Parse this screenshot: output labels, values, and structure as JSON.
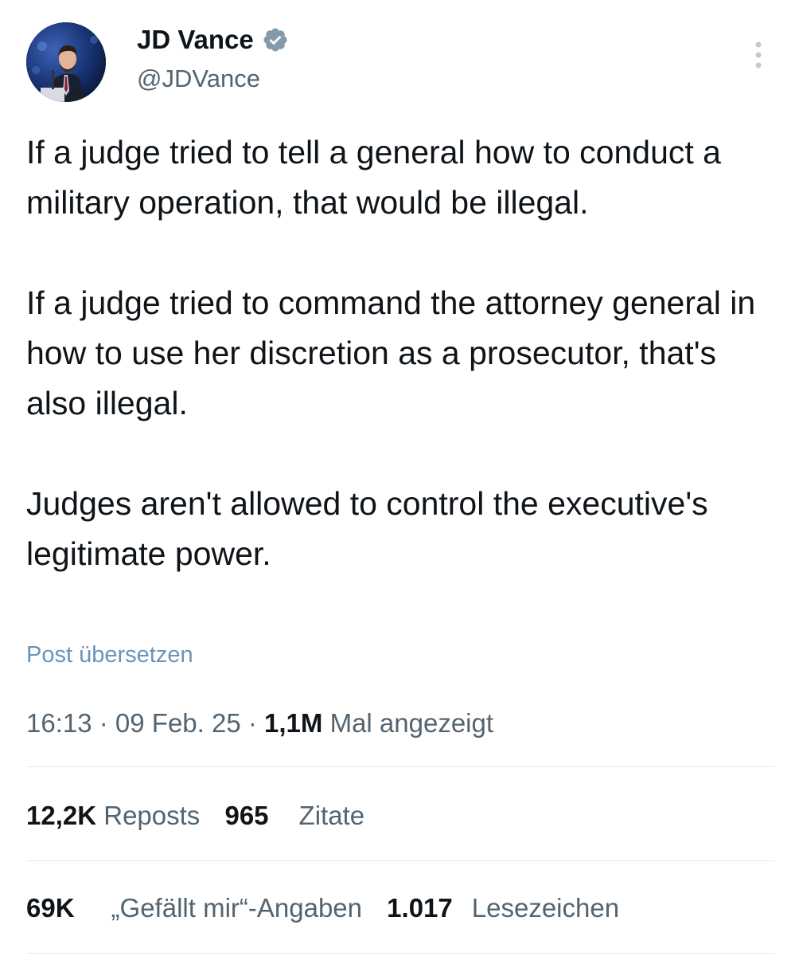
{
  "author": {
    "display_name": "JD Vance",
    "handle": "@JDVance",
    "verified": true,
    "avatar_icon": "profile-photo",
    "badge_color": "#829aab"
  },
  "header": {
    "more_icon": "more-vertical-icon"
  },
  "post": {
    "paragraphs": [
      "If a judge tried to tell a general how to conduct a military operation, that would be illegal.",
      "If a judge tried to command the attorney general in how to use her discretion as a prosecutor, that's also illegal.",
      "Judges aren't allowed to control the executive's legitimate power."
    ],
    "translate_label": "Post übersetzen"
  },
  "meta": {
    "time": "16:13",
    "separator": " · ",
    "date": "09 Feb. 25",
    "views_count": "1,1M",
    "views_label": " Mal angezeigt"
  },
  "stats": {
    "reposts_count": "12,2K",
    "reposts_label": "Reposts",
    "quotes_count": "965",
    "quotes_label": "Zitate",
    "likes_count": "69K",
    "likes_label": "„Gefällt mir“-Angaben",
    "bookmarks_count": "1.017",
    "bookmarks_label": "Lesezeichen"
  },
  "colors": {
    "text_primary": "#0f1419",
    "text_secondary": "#536471",
    "link": "#6b94b6",
    "divider": "#e6e9eb"
  }
}
